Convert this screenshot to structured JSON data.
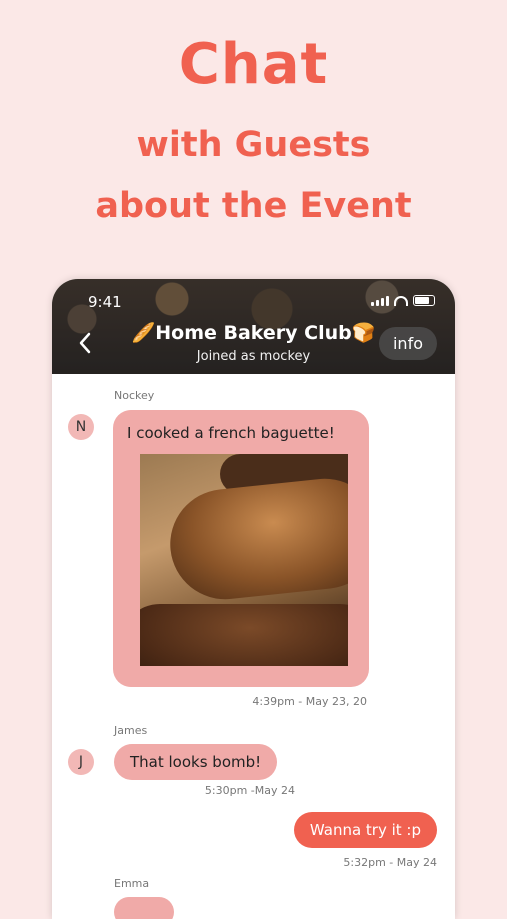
{
  "promo": {
    "line1": "Chat",
    "line2": "with Guests",
    "line3": "about the Event"
  },
  "status": {
    "time": "9:41"
  },
  "header": {
    "title": "🥖Home Bakery Club🍞",
    "subtitle": "Joined as mockey",
    "info": "info"
  },
  "messages": [
    {
      "sender": "Nockey",
      "avatar": "N",
      "text": "I cooked a french baguette!",
      "time": "4:39pm - May 23, 20"
    },
    {
      "sender": "James",
      "avatar": "J",
      "text": "That looks bomb!",
      "time": "5:30pm -May 24"
    },
    {
      "sender": "",
      "avatar": "",
      "text": "Wanna try it :p",
      "time": "5:32pm - May 24"
    },
    {
      "sender": "Emma",
      "avatar": "",
      "text": "",
      "time": ""
    }
  ],
  "colors": {
    "background": "#fbe8e7",
    "accent": "#f06150",
    "incoming_bubble": "#f0aaa8"
  }
}
